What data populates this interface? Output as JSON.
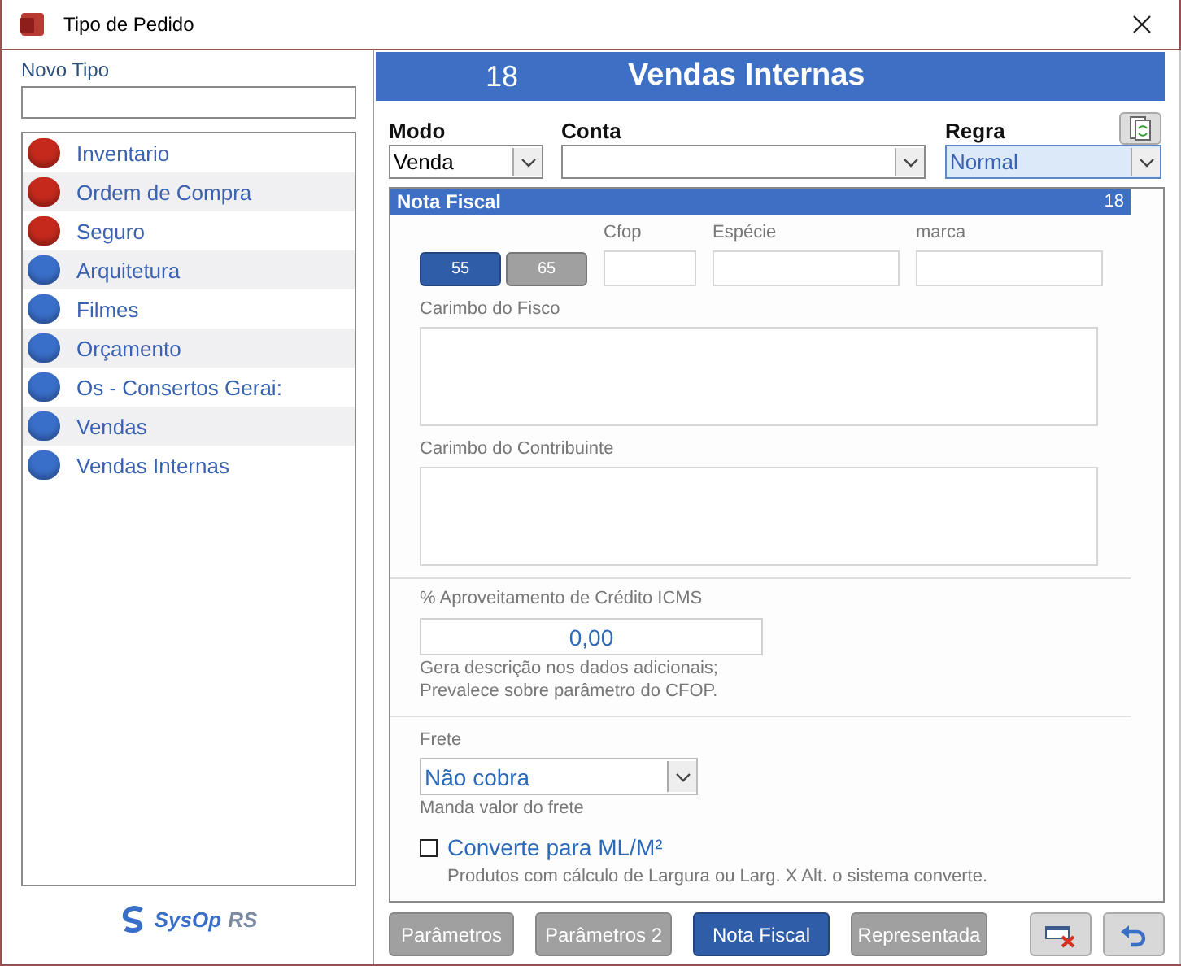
{
  "window": {
    "title": "Tipo de Pedido"
  },
  "sidebar": {
    "new_type": {
      "label": "Novo Tipo"
    },
    "items": [
      {
        "label": "Inventario",
        "color": "#c4291c"
      },
      {
        "label": "Ordem de Compra",
        "color": "#c4291c"
      },
      {
        "label": "Seguro",
        "color": "#c4291c"
      },
      {
        "label": "Arquitetura",
        "color": "#3a6fc9"
      },
      {
        "label": "Filmes",
        "color": "#3a6fc9"
      },
      {
        "label": "Orçamento",
        "color": "#3a6fc9"
      },
      {
        "label": "Os - Consertos Gerai:",
        "color": "#3a6fc9"
      },
      {
        "label": "Vendas",
        "color": "#3a6fc9"
      },
      {
        "label": "Vendas Internas",
        "color": "#3a6fc9"
      }
    ],
    "logo": {
      "name": "SysOp",
      "suffix": "RS"
    }
  },
  "header": {
    "number": "18",
    "title": "Vendas Internas"
  },
  "fields": {
    "modo": {
      "label": "Modo",
      "value": "Venda"
    },
    "conta": {
      "label": "Conta"
    },
    "regra": {
      "label": "Regra",
      "value": "Normal",
      "focused": true
    }
  },
  "nota_fiscal": {
    "title": "Nota Fiscal",
    "number": "18",
    "models": [
      {
        "label": "55",
        "selected": true
      },
      {
        "label": "65",
        "selected": false
      }
    ],
    "cfop": {
      "label": "Cfop"
    },
    "especie": {
      "label": "Espécie"
    },
    "marca": {
      "label": "marca"
    },
    "carimbo_fisco": {
      "label": "Carimbo do Fisco"
    },
    "carimbo_contribuinte": {
      "label": "Carimbo do Contribuinte"
    },
    "credito_icms": {
      "label": "% Aproveitamento de Crédito ICMS",
      "value": "0,00",
      "help": [
        "Gera descrição nos dados adicionais;",
        "Prevalece sobre parâmetro do CFOP."
      ]
    },
    "frete": {
      "label": "Frete",
      "value": "Não cobra",
      "help": "Manda valor do frete"
    },
    "converte": {
      "label": "Converte para ML/M²",
      "checked": false,
      "help": "Produtos com cálculo de Largura ou Larg. X Alt. o sistema converte."
    }
  },
  "tabs": [
    {
      "label": "Parâmetros",
      "selected": false
    },
    {
      "label": "Parâmetros 2",
      "selected": false
    },
    {
      "label": "Nota Fiscal",
      "selected": true
    },
    {
      "label": "Representada",
      "selected": false
    }
  ],
  "actions": [
    {
      "kind": "delete"
    },
    {
      "kind": "undo"
    }
  ]
}
